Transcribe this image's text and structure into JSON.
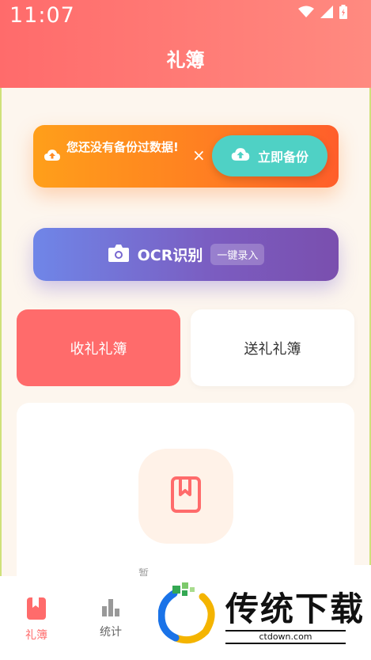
{
  "status_bar": {
    "time": "11:07"
  },
  "header": {
    "title": "礼簿"
  },
  "backup_banner": {
    "message": "您还没有备份过数据!",
    "close": "×",
    "button_label": "立即备份"
  },
  "ocr": {
    "label": "OCR识别",
    "chip": "一键录入"
  },
  "tabs": [
    {
      "label": "收礼礼簿",
      "active": true
    },
    {
      "label": "送礼礼簿",
      "active": false
    }
  ],
  "empty_state": {
    "hint_partial": "暂"
  },
  "bottom_nav": [
    {
      "label": "礼簿",
      "icon": "book-icon",
      "active": true
    },
    {
      "label": "统计",
      "icon": "bar-chart-icon",
      "active": false
    }
  ],
  "watermark": {
    "brand": "传统下载",
    "url": "ctdown.com"
  },
  "colors": {
    "accent": "#ff6b6b",
    "backup_orange": "#ff8c2a",
    "backup_button": "#4fd1c5",
    "ocr_purple": "#7666d0"
  }
}
